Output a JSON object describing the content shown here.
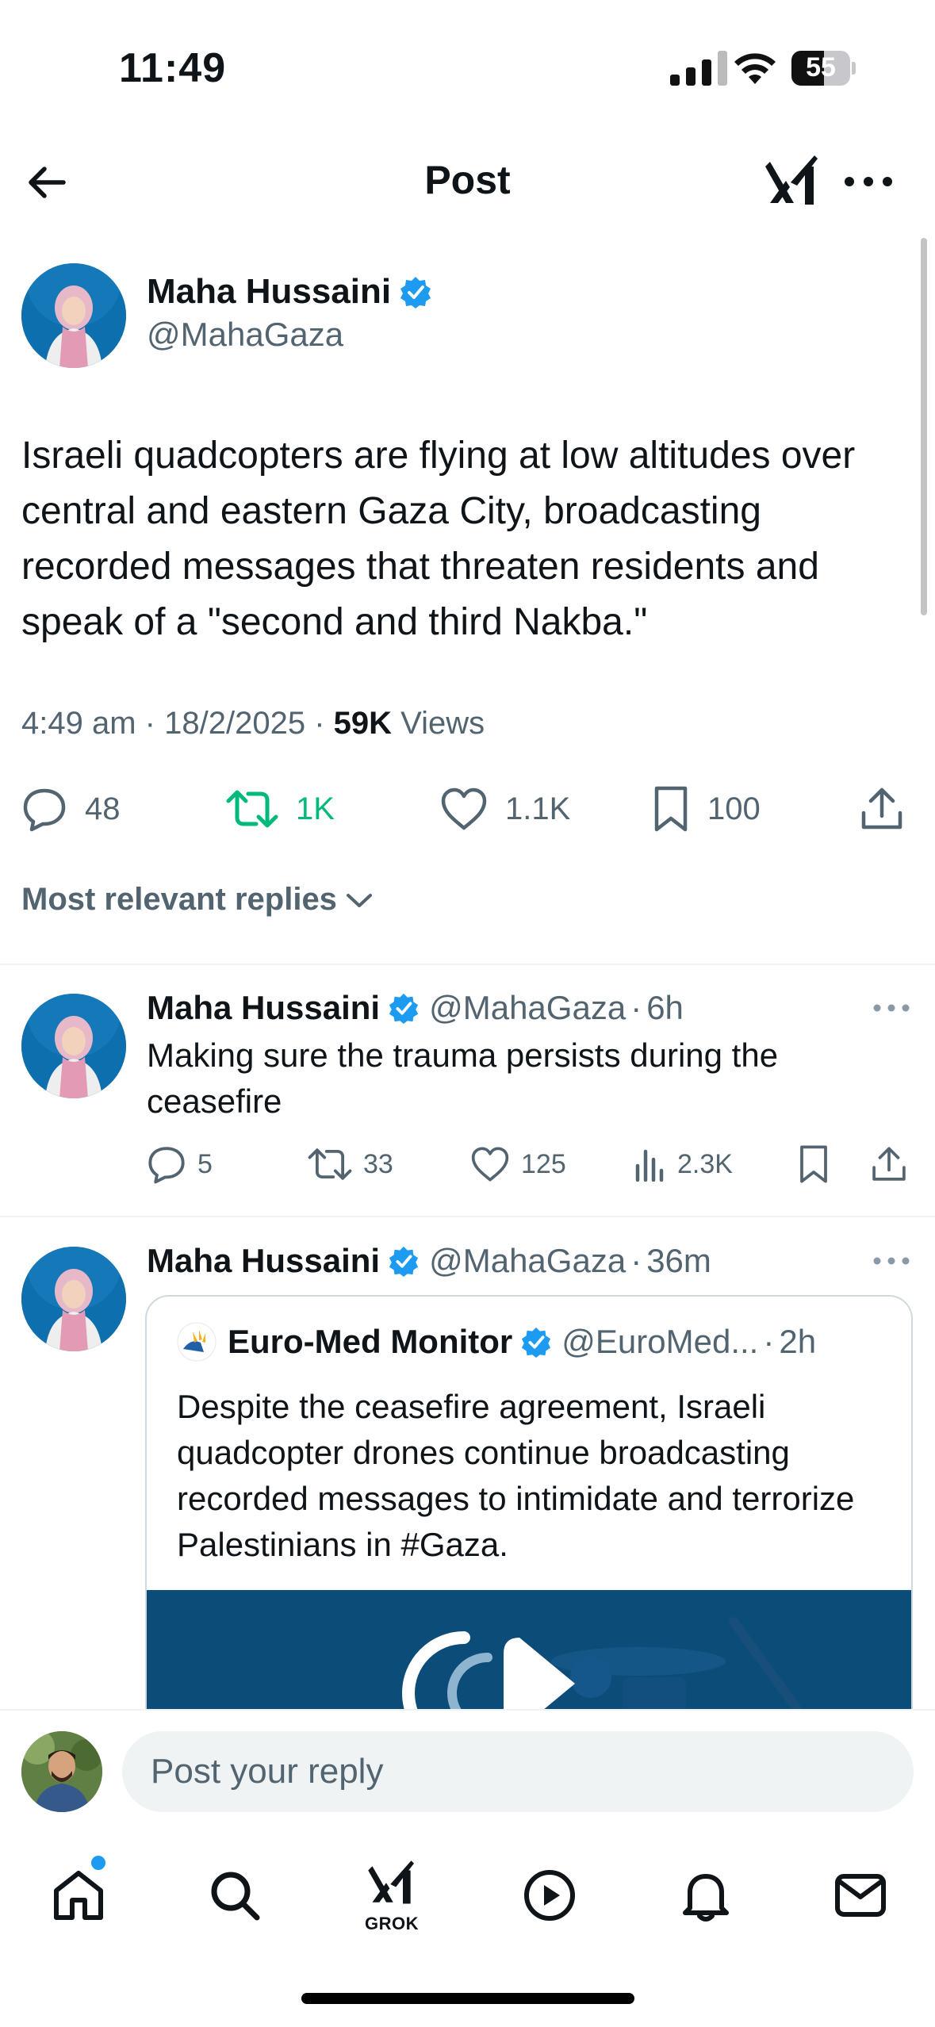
{
  "status_bar": {
    "time": "11:49",
    "battery": "55",
    "battery_level": 0.55
  },
  "nav": {
    "title": "Post"
  },
  "post": {
    "author_name": "Maha Hussaini",
    "author_handle": "@MahaGaza",
    "text": "Israeli quadcopters are flying at low altitudes over central and eastern Gaza City, broadcasting recorded messages that threaten residents and speak of a \"second and third Nakba.\"",
    "time": "4:49 am",
    "date": "18/2/2025",
    "views_count": "59K",
    "views_label": "Views",
    "separator": "·",
    "replies": "48",
    "reposts": "1K",
    "likes": "1.1K",
    "bookmarks": "100"
  },
  "sort": {
    "label": "Most relevant replies"
  },
  "replies": [
    {
      "name": "Maha Hussaini",
      "handle": "@MahaGaza",
      "time": "6h",
      "text": "Making sure the trauma persists during the ceasefire",
      "replies": "5",
      "reposts": "33",
      "likes": "125",
      "views": "2.3K"
    },
    {
      "name": "Maha Hussaini",
      "handle": "@MahaGaza",
      "time": "36m",
      "quote": {
        "name": "Euro-Med Monitor",
        "handle": "@EuroMed...",
        "time": "2h",
        "text": "Despite the ceasefire agreement, Israeli quadcopter drones continue broadcasting recorded messages to intimidate and terrorize Palestinians in #Gaza."
      }
    }
  ],
  "reply_bar": {
    "placeholder": "Post your reply"
  },
  "tabbar": {
    "grok_label": "GROK"
  },
  "colors": {
    "accent": "#1d9bf0",
    "repost_green": "#00ba7c",
    "secondary_text": "#536471"
  }
}
